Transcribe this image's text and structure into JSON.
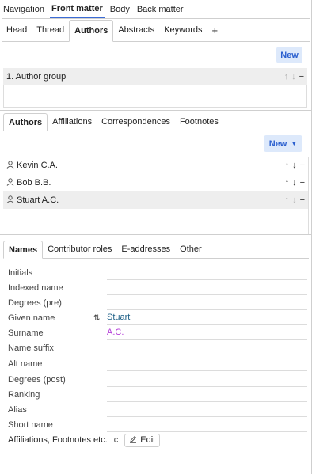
{
  "top_tabs": [
    {
      "label": "Navigation",
      "active": false
    },
    {
      "label": "Front matter",
      "active": true
    },
    {
      "label": "Body",
      "active": false
    },
    {
      "label": "Back matter",
      "active": false
    }
  ],
  "sub_tabs": [
    {
      "label": "Head",
      "active": false
    },
    {
      "label": "Thread",
      "active": false
    },
    {
      "label": "Authors",
      "active": true
    },
    {
      "label": "Abstracts",
      "active": false
    },
    {
      "label": "Keywords",
      "active": false
    }
  ],
  "sub_tabs_add": "+",
  "groups": {
    "new_label": "New",
    "items": [
      {
        "label": "1. Author group"
      }
    ]
  },
  "author_tabs": [
    {
      "label": "Authors",
      "active": true
    },
    {
      "label": "Affiliations",
      "active": false
    },
    {
      "label": "Correspondences",
      "active": false
    },
    {
      "label": "Footnotes",
      "active": false
    }
  ],
  "authors": {
    "new_label": "New",
    "items": [
      {
        "name": "Kevin C.A.",
        "selected": false,
        "up_enabled": false,
        "down_enabled": true
      },
      {
        "name": "Bob B.B.",
        "selected": false,
        "up_enabled": true,
        "down_enabled": true
      },
      {
        "name": "Stuart A.C.",
        "selected": true,
        "up_enabled": true,
        "down_enabled": false
      }
    ]
  },
  "names_tabs": [
    {
      "label": "Names",
      "active": true
    },
    {
      "label": "Contributor roles",
      "active": false
    },
    {
      "label": "E-addresses",
      "active": false
    },
    {
      "label": "Other",
      "active": false
    }
  ],
  "fields": [
    {
      "label": "Initials",
      "value": ""
    },
    {
      "label": "Indexed name",
      "value": ""
    },
    {
      "label": "Degrees (pre)",
      "value": ""
    },
    {
      "label": "Given name",
      "value": "Stuart"
    },
    {
      "label": "Surname",
      "value": "A.C."
    },
    {
      "label": "Name suffix",
      "value": ""
    },
    {
      "label": "Alt name",
      "value": ""
    },
    {
      "label": "Degrees (post)",
      "value": ""
    },
    {
      "label": "Ranking",
      "value": ""
    },
    {
      "label": "Alias",
      "value": ""
    },
    {
      "label": "Short name",
      "value": ""
    }
  ],
  "affiliations": {
    "label": "Affiliations, Footnotes etc.",
    "value": "c",
    "edit_label": "Edit"
  },
  "icons": {
    "up": "↑",
    "down": "↓",
    "remove": "−",
    "swap": "⇅",
    "person": "person-icon",
    "pencil": "pencil-icon"
  },
  "colors": {
    "accent": "#2a5fcf",
    "accent_bg": "#dde9fb",
    "selected_row": "#eeeeee",
    "given_name": "#1b5e86",
    "surname": "#b33bd8"
  }
}
